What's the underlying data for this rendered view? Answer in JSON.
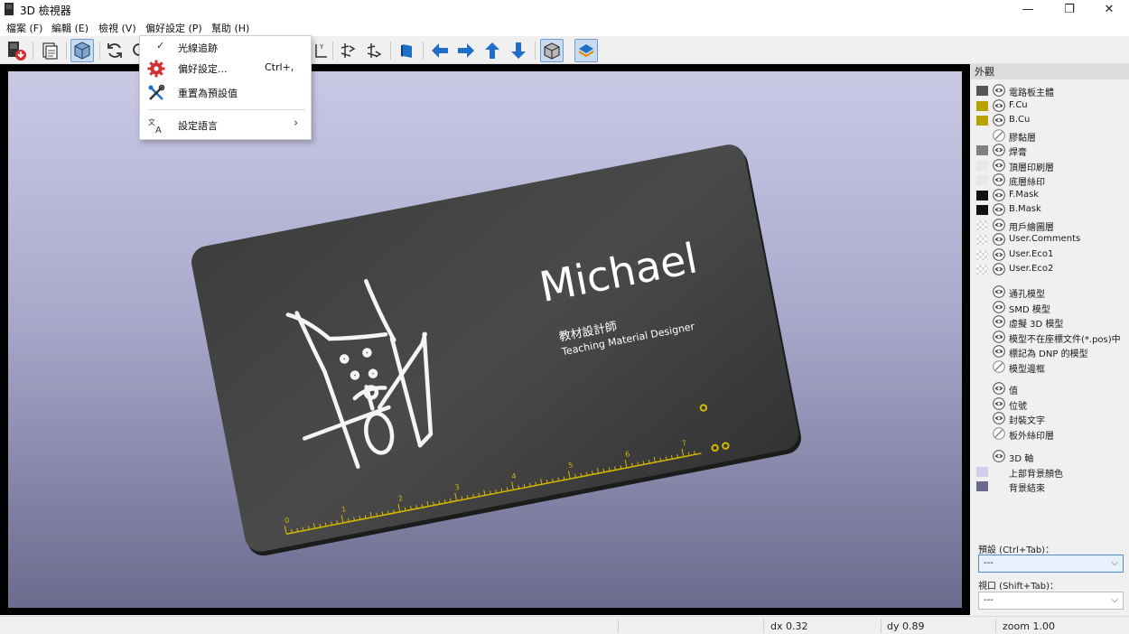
{
  "window": {
    "title": "3D 檢視器",
    "minimize": "—",
    "restore": "❐",
    "close": "✕"
  },
  "menubar": [
    {
      "label": "檔案 (F)"
    },
    {
      "label": "編輯 (E)"
    },
    {
      "label": "檢視 (V)"
    },
    {
      "label": "偏好設定 (P)"
    },
    {
      "label": "幫助 (H)"
    }
  ],
  "toolbar": {
    "buttons": [
      "export-icon",
      "copy-icon",
      "render-options-icon",
      "reload-icon",
      "zoom-in-icon",
      "zoom-out-icon",
      "rotate-x-icon",
      "rotate-y-icon",
      "rotate-z-icon",
      "flip-board-icon",
      "move-left-icon",
      "move-right-icon",
      "move-up-icon",
      "move-down-icon",
      "orthographic-icon",
      "layers-icon"
    ]
  },
  "dropdown": {
    "items": [
      {
        "label": "光線追跡",
        "checked": true
      },
      {
        "label": "偏好設定...",
        "shortcut": "Ctrl+,",
        "icon": "gear-icon"
      },
      {
        "label": "重置為預設值",
        "icon": "tools-icon"
      },
      {
        "label": "設定語言",
        "icon": "language-icon",
        "submenu": "›"
      }
    ]
  },
  "board": {
    "name": "Michael",
    "title_zh": "教材設計師",
    "title_en": "Teaching Material Designer",
    "ruler_numbers": [
      "0",
      "1",
      "2",
      "3",
      "4",
      "5",
      "6",
      "7"
    ]
  },
  "panel": {
    "title": "外觀",
    "layers": [
      {
        "label": "電路板主體",
        "color": "#555555",
        "visible": true
      },
      {
        "label": "F.Cu",
        "color": "#b8a200",
        "visible": true
      },
      {
        "label": "B.Cu",
        "color": "#b8a200",
        "visible": true
      },
      {
        "label": "膠黏層",
        "color": "",
        "visible": false
      },
      {
        "label": "焊膏",
        "color": "#808080",
        "visible": true
      },
      {
        "label": "頂層印刷層",
        "color": "#e8e8e8",
        "visible": true
      },
      {
        "label": "底層絲印",
        "color": "#e8e8e8",
        "visible": true
      },
      {
        "label": "F.Mask",
        "color": "#111111",
        "visible": true
      },
      {
        "label": "B.Mask",
        "color": "#111111",
        "visible": true
      },
      {
        "label": "用戶繪圖層",
        "color": "checker",
        "visible": true
      },
      {
        "label": "User.Comments",
        "color": "checker",
        "visible": true
      },
      {
        "label": "User.Eco1",
        "color": "checker",
        "visible": true
      },
      {
        "label": "User.Eco2",
        "color": "checker",
        "visible": true
      }
    ],
    "models": [
      {
        "label": "通孔模型",
        "visible": true
      },
      {
        "label": "SMD 模型",
        "visible": true
      },
      {
        "label": "虛擬 3D 模型",
        "visible": true
      },
      {
        "label": "模型不在座標文件(*.pos)中",
        "visible": true
      },
      {
        "label": "標記為 DNP 的模型",
        "visible": true
      },
      {
        "label": "模型邊框",
        "visible": false
      }
    ],
    "texts": [
      {
        "label": "值",
        "visible": true
      },
      {
        "label": "位號",
        "visible": true
      },
      {
        "label": "封裝文字",
        "visible": true
      },
      {
        "label": "板外絲印層",
        "visible": false
      }
    ],
    "extras": [
      {
        "label": "3D 軸",
        "visible": true
      },
      {
        "label": "上部背景顏色",
        "color": "#cfcfea"
      },
      {
        "label": "背景結束",
        "color": "#6a6a8c"
      }
    ],
    "preset_label": "預設 (Ctrl+Tab)：",
    "preset_value": "---",
    "viewport_label": "視口 (Shift+Tab)：",
    "viewport_value": "---"
  },
  "status": {
    "dx": "dx 0.32",
    "dy": "dy 0.89",
    "zoom": "zoom 1.00"
  },
  "colors": {
    "board": "#3a3a3a",
    "silkscreen": "#ffffff",
    "copper": "#d4b800",
    "accent_blue": "#1f6fc8"
  }
}
